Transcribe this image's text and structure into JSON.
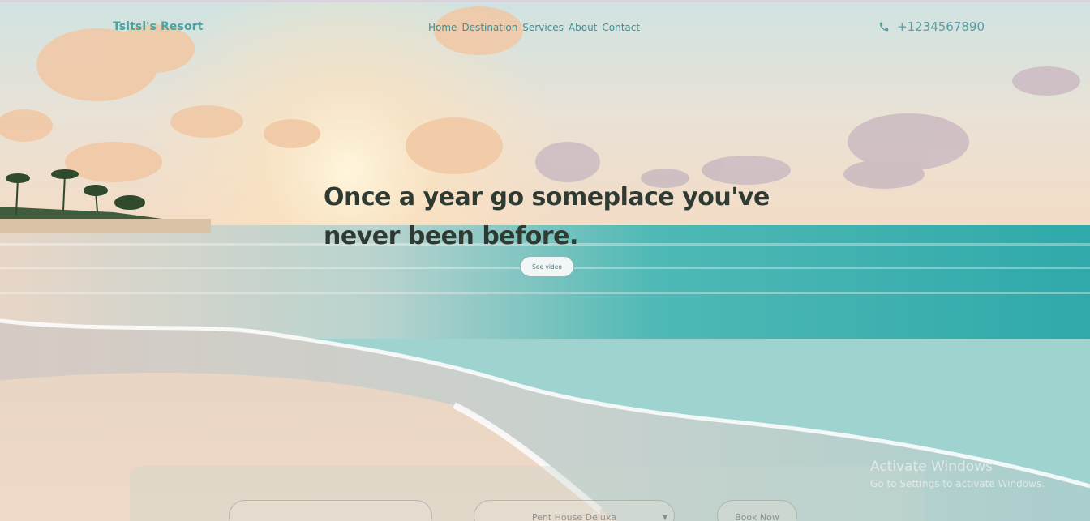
{
  "header": {
    "brand": "Tsitsi's Resort",
    "nav": [
      "Home",
      "Destination",
      "Services",
      "About",
      "Contact"
    ],
    "phone": "+1234567890",
    "phone_icon": "phone-icon"
  },
  "hero": {
    "headline_line1": "Once a year go someplace you've",
    "headline_line2": "never been before.",
    "cta_label": "See video"
  },
  "booking": {
    "room_select_value": "Pent House Deluxa",
    "book_label": "Book Now"
  },
  "os_watermark": {
    "title": "Activate Windows",
    "subtitle": "Go to Settings to activate Windows."
  },
  "colors": {
    "brand": "#4aa3a2",
    "nav": "#3f8f95",
    "headline": "#2f3a33",
    "sea": "#3fb3b0"
  }
}
